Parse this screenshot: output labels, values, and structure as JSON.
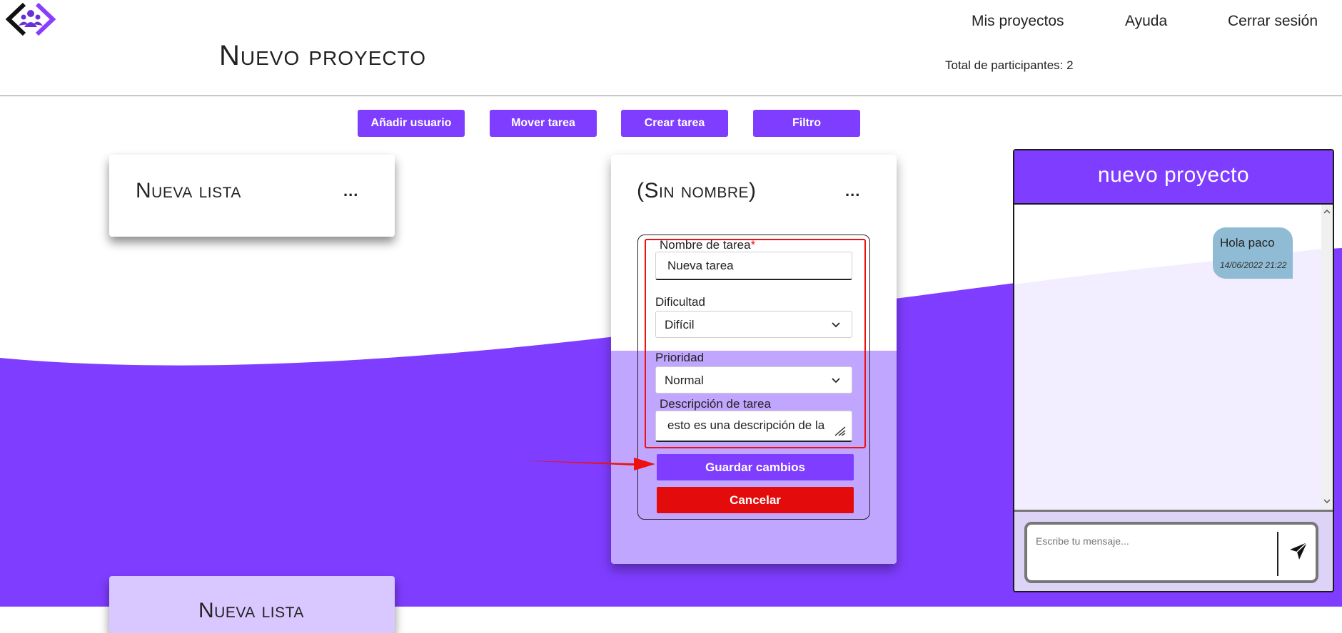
{
  "nav": {
    "my_projects": "Mis proyectos",
    "help": "Ayuda",
    "logout": "Cerrar sesión"
  },
  "header": {
    "title": "Nuevo proyecto",
    "participants": "Total de participantes: 2"
  },
  "toolbar": {
    "add_user": "Añadir usuario",
    "move_task": "Mover tarea",
    "create_task": "Crear tarea",
    "filter": "Filtro"
  },
  "lists": [
    {
      "title": "Nueva lista",
      "menu": "..."
    },
    {
      "title": "(Sin nombre)",
      "menu": "..."
    },
    {
      "title": "Nueva lista"
    }
  ],
  "task_form": {
    "name_label": "Nombre de tarea",
    "required_mark": "*",
    "name_value": "Nueva tarea",
    "difficulty_label": "Dificultad",
    "difficulty_value": "Difícil",
    "priority_label": "Prioridad",
    "priority_value": "Normal",
    "description_label": "Descripción de tarea",
    "description_value": "esto es una descripción de la",
    "save_label": "Guardar cambios",
    "cancel_label": "Cancelar"
  },
  "chat": {
    "title": "nuevo proyecto",
    "messages": [
      {
        "text": "Hola paco",
        "time": "14/06/2022 21:22"
      }
    ],
    "input_placeholder": "Escribe tu mensaje..."
  },
  "colors": {
    "accent": "#7f3dff",
    "danger": "#e30b0b",
    "highlight": "#ee1111",
    "bubble": "#8fbcd4"
  },
  "icons": [
    "logo-icon",
    "ellipsis-icon",
    "chevron-down-icon",
    "resize-grip-icon",
    "send-icon",
    "arrow-annotation-icon"
  ]
}
